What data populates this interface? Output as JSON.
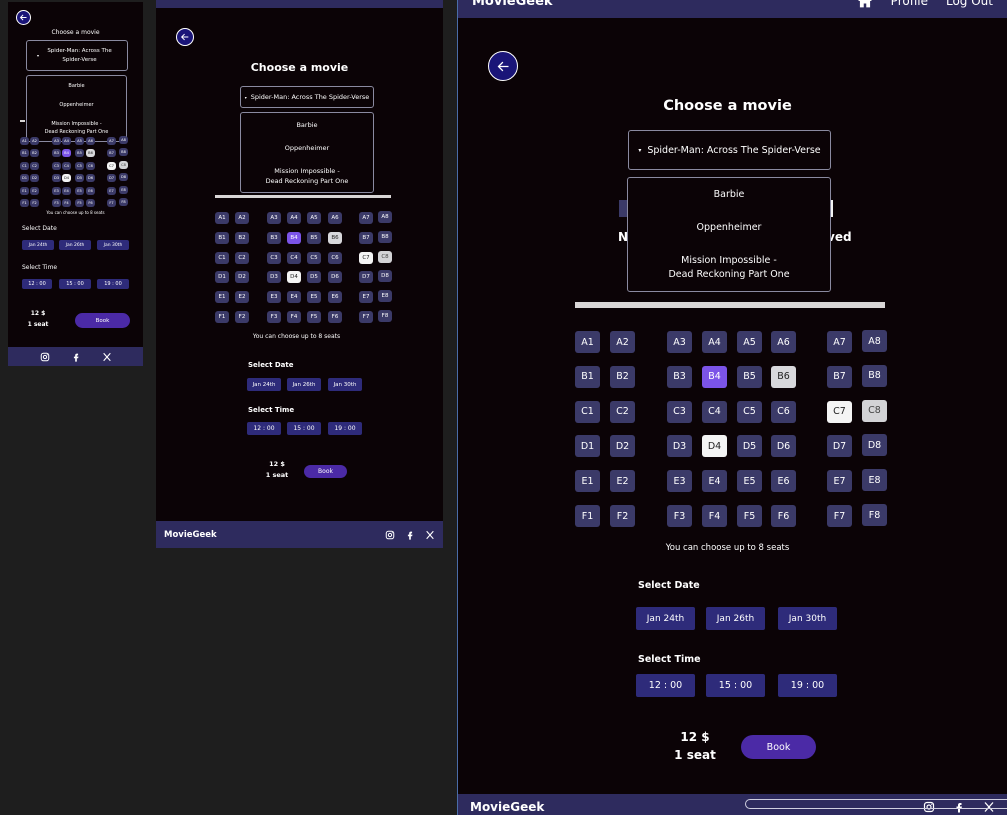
{
  "brand": "MovieGeek",
  "nav": {
    "profile": "Profile",
    "logout": "Log Out",
    "home_icon": "home-icon"
  },
  "title": "Choose a movie",
  "selected_movie": "Spider-Man: Across The  Spider-Verse",
  "selected_movie_sm": "Spider-Man: Across The Spider-Verse",
  "movies": [
    "Barbie",
    "Oppenheimer",
    "Mission Impossible - Dead Reckoning Part One"
  ],
  "movies_split": {
    "mi_line1": "Mission Impossible -",
    "mi_line2": "Dead Reckoning Part One"
  },
  "behind_text": {
    "left": "N",
    "right": "ved"
  },
  "seats": [
    [
      "A1",
      "A2",
      "A3",
      "A4",
      "A5",
      "A6",
      "A7",
      "A8"
    ],
    [
      "B1",
      "B2",
      "B3",
      "B4",
      "B5",
      "B6",
      "B7",
      "B8"
    ],
    [
      "C1",
      "C2",
      "C3",
      "C4",
      "C5",
      "C6",
      "C7",
      "C8"
    ],
    [
      "D1",
      "D2",
      "D3",
      "D4",
      "D5",
      "D6",
      "D7",
      "D8"
    ],
    [
      "E1",
      "E2",
      "E3",
      "E4",
      "E5",
      "E6",
      "E7",
      "E8"
    ],
    [
      "F1",
      "F2",
      "F3",
      "F4",
      "F5",
      "F6",
      "F7",
      "F8"
    ]
  ],
  "seat_states": {
    "B4": "selected",
    "B6": "lightgray",
    "C7": "white",
    "C8": "gray",
    "D4": "white"
  },
  "seat_note": "You can choose up to 8 seats",
  "select_date_label": "Select Date",
  "dates": [
    "Jan 24th",
    "Jan 26th",
    "Jan 30th"
  ],
  "select_time_label": "Select Time",
  "times": [
    "12 : 00",
    "15 : 00",
    "19 : 00"
  ],
  "price": "12 $",
  "seat_count": "1 seat",
  "book_label": "Book",
  "social_icons": [
    "instagram-icon",
    "facebook-icon",
    "x-icon"
  ],
  "colors": {
    "background": "#0b0306",
    "bar": "#2e2b5e",
    "seat": "#3b3a68",
    "selected": "#7b54e8",
    "chip": "#2e2b7a",
    "book": "#4b2aa6"
  }
}
